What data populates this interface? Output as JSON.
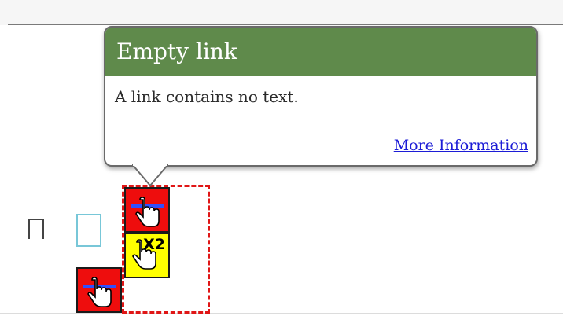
{
  "tooltip": {
    "title": "Empty link",
    "message": "A link contains no text.",
    "more_info_link": "More Information",
    "header_color": "#5f8a4b"
  },
  "badges": [
    {
      "name": "empty-link-error",
      "color": "#ee0d0d",
      "icon": "hand-pointer-icon",
      "label": ""
    },
    {
      "name": "empty-link-warning-count",
      "color": "#ffff00",
      "icon": "hand-pointer-icon",
      "label": "X2"
    },
    {
      "name": "empty-link-error-secondary",
      "color": "#ee0d0d",
      "icon": "hand-pointer-icon",
      "label": ""
    }
  ],
  "focus_outline_color": "#e01616"
}
